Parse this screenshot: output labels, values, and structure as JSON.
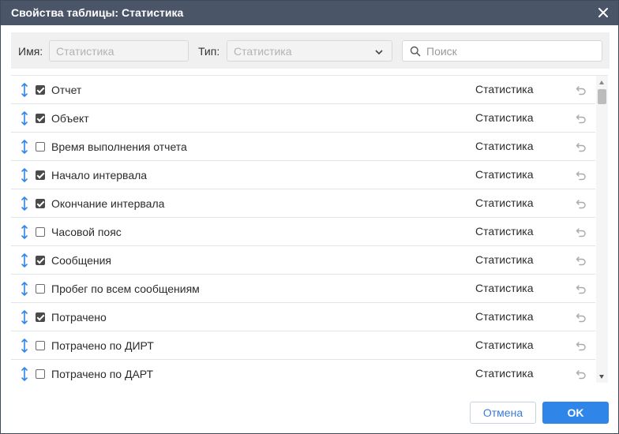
{
  "window": {
    "title": "Свойства таблицы: Статистика",
    "close_icon": "close-icon"
  },
  "filters": {
    "name_label": "Имя:",
    "name_value": "Статистика",
    "type_label": "Тип:",
    "type_value": "Статистика",
    "search_placeholder": "Поиск"
  },
  "rows": [
    {
      "name": "Отчет",
      "type": "Статистика",
      "checked": true
    },
    {
      "name": "Объект",
      "type": "Статистика",
      "checked": true
    },
    {
      "name": "Время выполнения отчета",
      "type": "Статистика",
      "checked": false
    },
    {
      "name": "Начало интервала",
      "type": "Статистика",
      "checked": true
    },
    {
      "name": "Окончание интервала",
      "type": "Статистика",
      "checked": true
    },
    {
      "name": "Часовой пояс",
      "type": "Статистика",
      "checked": false
    },
    {
      "name": "Сообщения",
      "type": "Статистика",
      "checked": true
    },
    {
      "name": "Пробег по всем сообщениям",
      "type": "Статистика",
      "checked": false
    },
    {
      "name": "Потрачено",
      "type": "Статистика",
      "checked": true
    },
    {
      "name": "Потрачено по ДИРТ",
      "type": "Статистика",
      "checked": false
    },
    {
      "name": "Потрачено по ДАРТ",
      "type": "Статистика",
      "checked": false
    }
  ],
  "buttons": {
    "cancel": "Отмена",
    "ok": "OK"
  },
  "colors": {
    "titlebar": "#4a5568",
    "accent": "#2f86e8",
    "drag_icon": "#2f86e8"
  }
}
